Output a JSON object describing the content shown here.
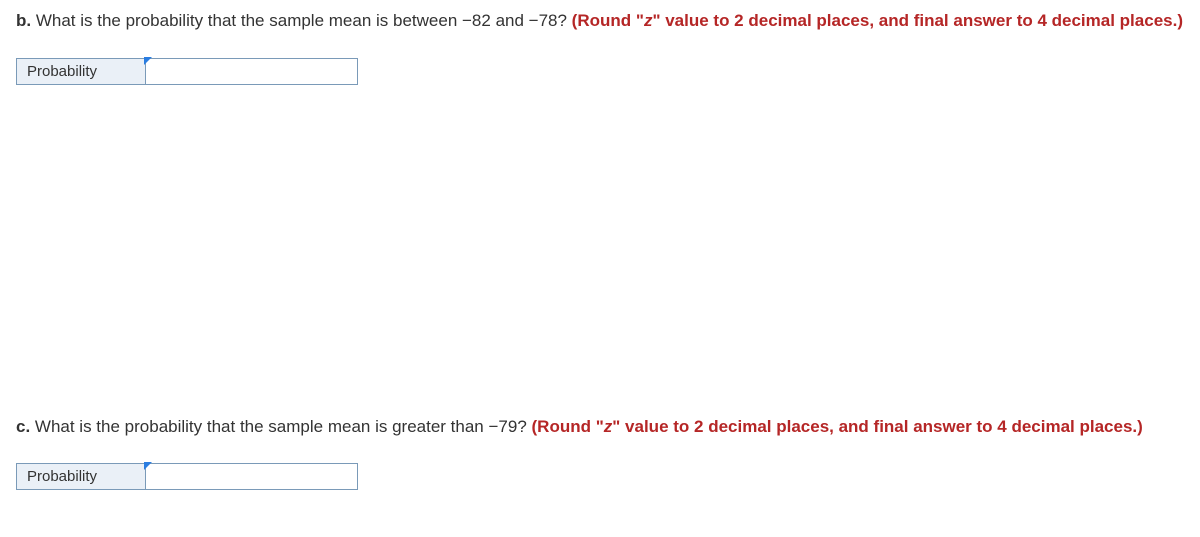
{
  "questions": [
    {
      "label": "b.",
      "text": " What is the probability that the sample mean is between −82 and −78? ",
      "instruction_prefix": "(Round \"",
      "instruction_z": "z",
      "instruction_suffix": "\" value to 2 decimal places, and final answer to 4 decimal places.)",
      "answer_label": "Probability",
      "answer_value": ""
    },
    {
      "label": "c.",
      "text": " What is the probability that the sample mean is greater than −79? ",
      "instruction_prefix": "(Round \"",
      "instruction_z": "z",
      "instruction_suffix": "\" value to 2 decimal places, and final answer to 4 decimal places.)",
      "answer_label": "Probability",
      "answer_value": ""
    }
  ]
}
